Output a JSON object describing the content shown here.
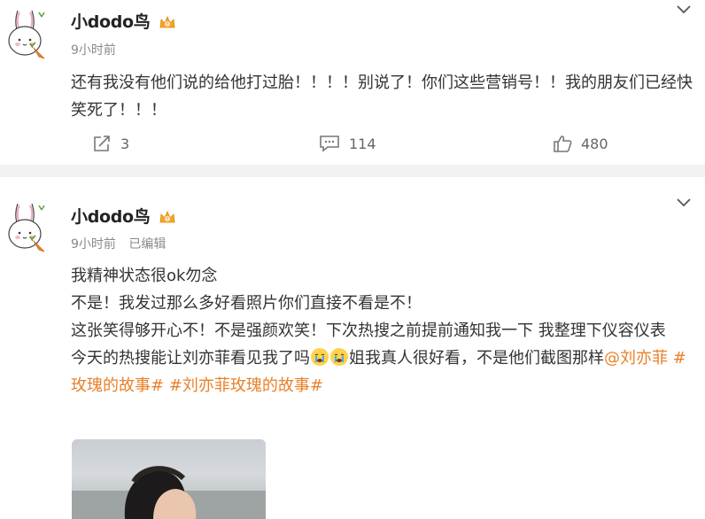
{
  "posts": [
    {
      "username": "小dodo鸟",
      "time": "9小时前",
      "edited": "",
      "text": "还有我没有他们说的给他打过胎！！！！别说了！你们这些营销号！！我的朋友们已经快笑死了！！！",
      "actions": {
        "repost": "3",
        "comment": "114",
        "like": "480"
      }
    },
    {
      "username": "小dodo鸟",
      "time": "9小时前",
      "edited": "已编辑",
      "lines": [
        "我精神状态很ok勿念",
        "不是！我发过那么多好看照片你们直接不看是不！",
        "这张笑得够开心不！不是强颜欢笑！下次热搜之前提前通知我一下 我整理下仪容仪表"
      ],
      "line4_pre": "今天的热搜能让刘亦菲看见我了吗",
      "line4_post": "姐我真人很好看，不是他们截图那样",
      "mention": "@刘亦菲",
      "hashtag1": "#玫瑰的故事#",
      "hashtag2": "#刘亦菲玫瑰的故事#"
    }
  ],
  "colors": {
    "link": "#e8812a",
    "divider": "#f2f2f2",
    "meta": "#8a8a8a"
  },
  "icons": [
    "avatar-rabbit",
    "vip-crown-icon",
    "chevron-down-icon",
    "repost-icon",
    "comment-icon",
    "like-icon",
    "crying-emoji"
  ]
}
